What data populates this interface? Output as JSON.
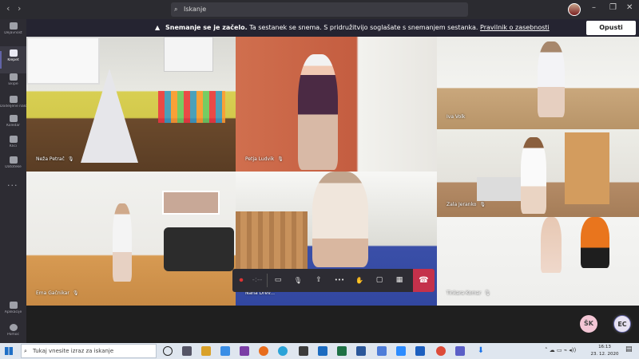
{
  "titlebar": {
    "back": "‹",
    "forward": "›",
    "search_placeholder": "Iskanje",
    "minimize": "–",
    "maximize": "❐",
    "close": "✕"
  },
  "rail": {
    "items": [
      {
        "label": "Dejavnost",
        "icon": "bell-icon"
      },
      {
        "label": "Klepet",
        "icon": "chat-icon",
        "active": true
      },
      {
        "label": "Ekipe",
        "icon": "teams-icon"
      },
      {
        "label": "Dodeljene naloge",
        "icon": "assignments-icon"
      },
      {
        "label": "Koledar",
        "icon": "calendar-icon"
      },
      {
        "label": "Klici",
        "icon": "phone-icon"
      },
      {
        "label": "Datoteke",
        "icon": "files-icon"
      }
    ],
    "more": "···",
    "apps": "Aplikacije",
    "help": "Pomoč"
  },
  "banner": {
    "bold": "Snemanje se je začelo.",
    "text": " Ta sestanek se snema. S pridružitvijo soglašate s snemanjem sestanka. ",
    "link": "Pravilnik o zasebnosti",
    "leave_button": "Opusti"
  },
  "participants": [
    {
      "name": "Neža Petrač"
    },
    {
      "name": "Petja Ludvik"
    },
    {
      "name": "Iva Volk"
    },
    {
      "name": "Zala Jeranko"
    },
    {
      "name": "Ema Gačnikar"
    },
    {
      "name": "Nana Drev..."
    },
    {
      "name": "Tinkara Komar"
    }
  ],
  "call_toolbar": {
    "record": "⏺",
    "timer": "-:--",
    "video": "▭",
    "mic": "🎙",
    "share": "⇪",
    "more": "•••",
    "hand": "✋",
    "chat": "▢",
    "rooms": "▦",
    "hangup": "☎"
  },
  "avatars": [
    {
      "initials": "ŠK"
    },
    {
      "initials": "EC"
    }
  ],
  "taskbar": {
    "search_placeholder": "Tukaj vnesite izraz za iskanje",
    "time": "16:13",
    "date": "23. 12. 2020"
  },
  "colors": {
    "accent": "#6264a7",
    "hangup": "#c4314b",
    "banner_bg": "#252431"
  }
}
